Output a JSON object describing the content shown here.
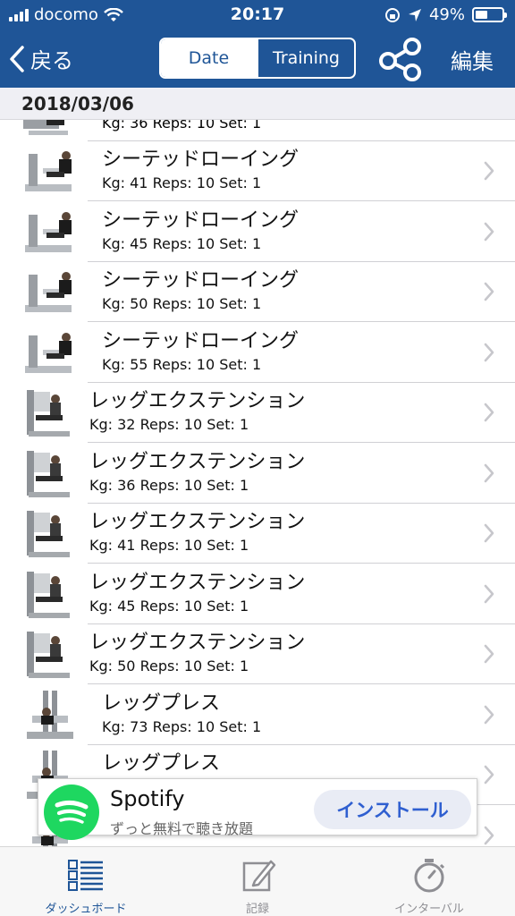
{
  "status_bar": {
    "carrier": "docomo",
    "time": "20:17",
    "battery": "49%"
  },
  "nav": {
    "back_label": "戻る",
    "segments": [
      "Date",
      "Training"
    ],
    "selected_segment": "Date",
    "share_icon": "share-icon",
    "edit_label": "編集"
  },
  "section": {
    "date": "2018/03/06"
  },
  "partial_row": {
    "detail": "Kg: 36 Reps: 10 Set: 1"
  },
  "rows": [
    {
      "name": "シーテッドローイング",
      "detail": "Kg: 41 Reps: 10 Set: 1",
      "kind": "row"
    },
    {
      "name": "シーテッドローイング",
      "detail": "Kg: 45 Reps: 10 Set: 1",
      "kind": "row"
    },
    {
      "name": "シーテッドローイング",
      "detail": "Kg: 50 Reps: 10 Set: 1",
      "kind": "row"
    },
    {
      "name": "シーテッドローイング",
      "detail": "Kg: 55 Reps: 10 Set: 1",
      "kind": "row"
    },
    {
      "name": "レッグエクステンション",
      "detail": "Kg: 32 Reps: 10 Set: 1",
      "kind": "ext"
    },
    {
      "name": "レッグエクステンション",
      "detail": "Kg: 36 Reps: 10 Set: 1",
      "kind": "ext"
    },
    {
      "name": "レッグエクステンション",
      "detail": "Kg: 41 Reps: 10 Set: 1",
      "kind": "ext"
    },
    {
      "name": "レッグエクステンション",
      "detail": "Kg: 45 Reps: 10 Set: 1",
      "kind": "ext"
    },
    {
      "name": "レッグエクステンション",
      "detail": "Kg: 50 Reps: 10 Set: 1",
      "kind": "ext"
    },
    {
      "name": "レッグプレス",
      "detail": "Kg: 73 Reps: 10 Set: 1",
      "kind": "press"
    },
    {
      "name": "レッグプレス",
      "detail": "",
      "kind": "press"
    },
    {
      "name": "",
      "detail": "",
      "kind": "press"
    }
  ],
  "ad": {
    "title": "Spotify",
    "subtitle": "ずっと無料で聴き放題",
    "install_label": "インストール",
    "brand_color": "#1ed760"
  },
  "tabs": [
    {
      "label": "ダッシュボード",
      "icon": "dashboard-icon",
      "active": true
    },
    {
      "label": "記録",
      "icon": "record-icon",
      "active": false
    },
    {
      "label": "インターバル",
      "icon": "stopwatch-icon",
      "active": false
    }
  ],
  "colors": {
    "nav_bar": "#1f5597",
    "accent": "#1f5597"
  }
}
